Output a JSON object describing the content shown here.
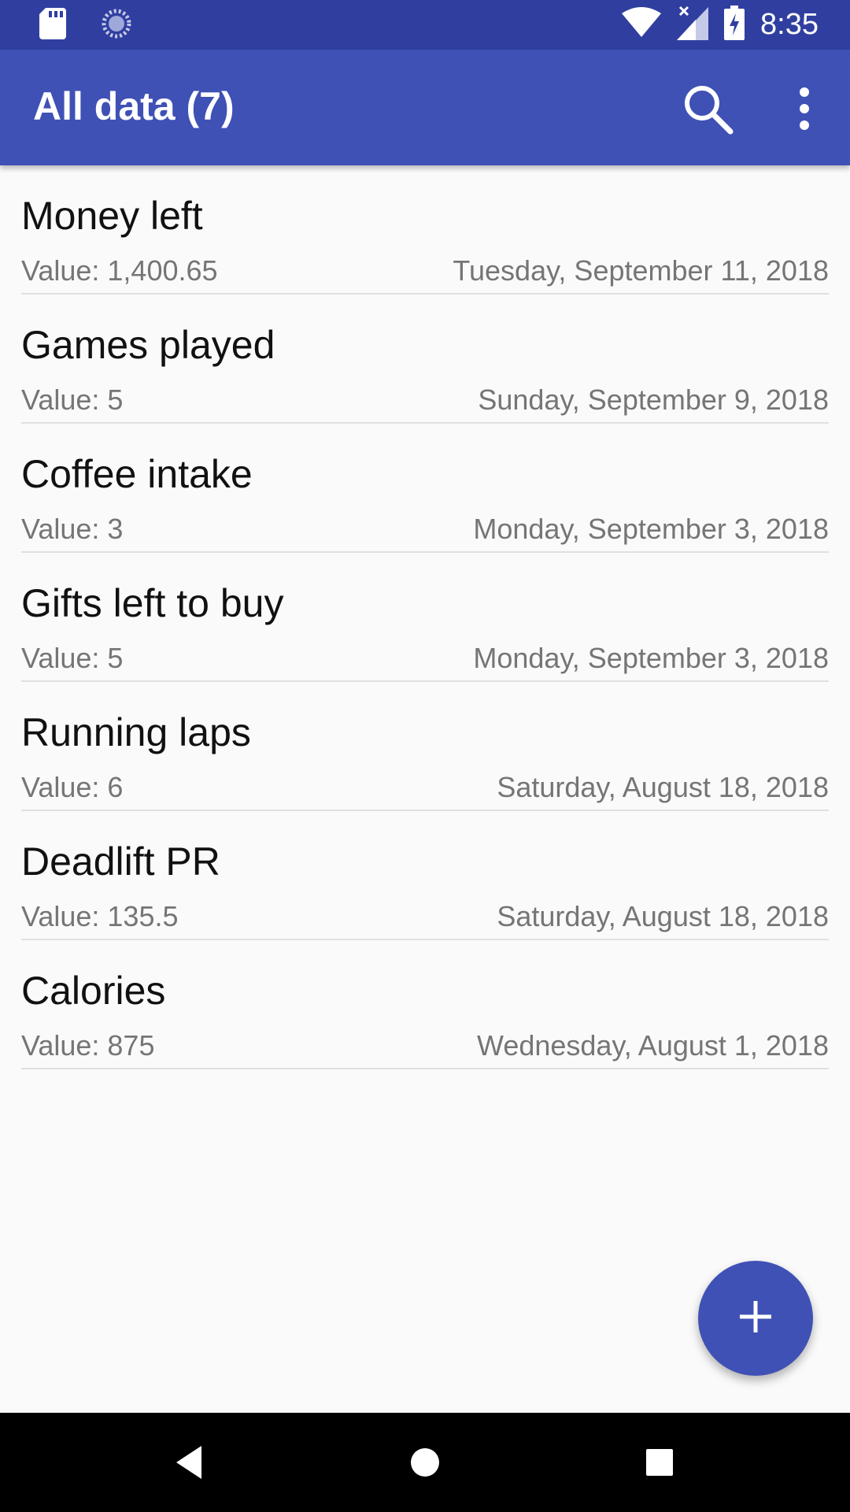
{
  "status_bar": {
    "time": "8:35",
    "icons": [
      "sd-card-icon",
      "sync-icon",
      "wifi-icon",
      "signal-icon",
      "battery-charging-icon"
    ]
  },
  "app_bar": {
    "title": "All data (7)",
    "search_icon": "search-icon",
    "menu_icon": "more-vert-icon"
  },
  "items": [
    {
      "name": "Money left",
      "value": "Value: 1,400.65",
      "date": "Tuesday, September 11, 2018"
    },
    {
      "name": "Games played",
      "value": "Value: 5",
      "date": "Sunday, September 9, 2018"
    },
    {
      "name": "Coffee intake",
      "value": "Value: 3",
      "date": "Monday, September 3, 2018"
    },
    {
      "name": "Gifts left to buy",
      "value": "Value: 5",
      "date": "Monday, September 3, 2018"
    },
    {
      "name": "Running laps",
      "value": "Value: 6",
      "date": "Saturday, August 18, 2018"
    },
    {
      "name": "Deadlift PR",
      "value": "Value: 135.5",
      "date": "Saturday, August 18, 2018"
    },
    {
      "name": "Calories",
      "value": "Value: 875",
      "date": "Wednesday, August 1, 2018"
    }
  ],
  "fab": {
    "icon": "add-icon"
  },
  "nav_bar": {
    "icons": [
      "back-icon",
      "home-icon",
      "recents-icon"
    ]
  },
  "colors": {
    "primary": "#3f51b5",
    "primary_dark": "#303f9f",
    "background": "#fafafa",
    "secondary_text": "#757575"
  }
}
